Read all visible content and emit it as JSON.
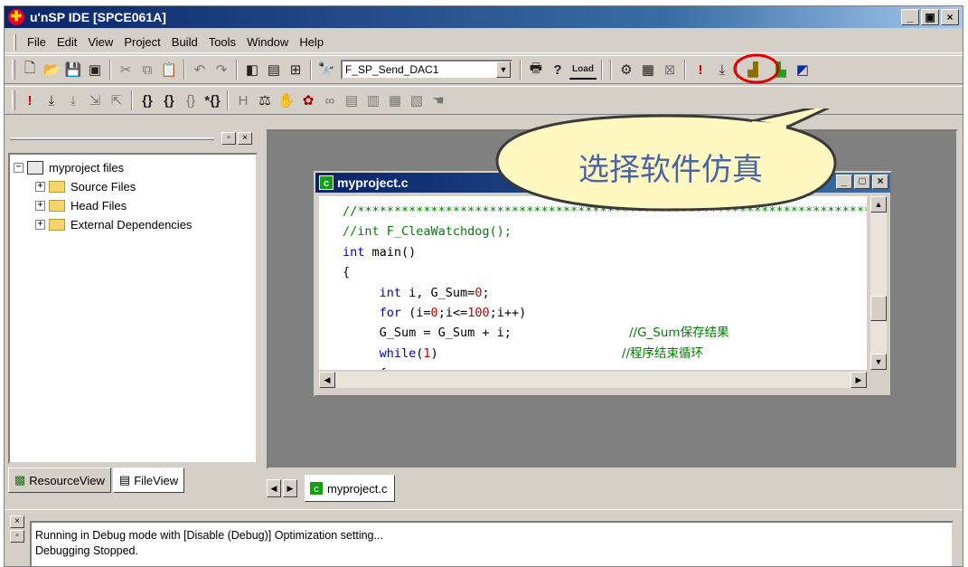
{
  "window": {
    "title": "u'nSP IDE [SPCE061A]",
    "min": "_",
    "max": "▣",
    "close": "×"
  },
  "menu": [
    "File",
    "Edit",
    "View",
    "Project",
    "Build",
    "Tools",
    "Window",
    "Help"
  ],
  "toolbar": {
    "function_combo": "F_SP_Send_DAC1",
    "load_label": "Load"
  },
  "callout": {
    "text": "选择软件仿真"
  },
  "left_pane": {
    "root": "myproject files",
    "items": [
      "Source Files",
      "Head Files",
      "External Dependencies"
    ],
    "tabs": [
      "ResourceView",
      "FileView"
    ]
  },
  "editor": {
    "title": "myproject.c",
    "tab_label": "myproject.c",
    "line1": "//**************************************************************************",
    "line2": "//int F_CleaWatchdog();",
    "line3_kw": "int",
    "line3_rest": " main()",
    "line4": "{",
    "line5_kw": "int",
    "line5_a": " i, G_Sum=",
    "line5_num": "0",
    "line5_b": ";",
    "line6_kw": "for",
    "line6_a": " (i=",
    "line6_n1": "0",
    "line6_b": ";i<=",
    "line6_n2": "100",
    "line6_c": ";i++)",
    "line7": "G_Sum = G_Sum + i;",
    "line7_comment": "//G_Sum保存结果",
    "line8_kw": "while",
    "line8_a": "(",
    "line8_num": "1",
    "line8_b": ")",
    "line8_comment": "//程序结束循环",
    "line9": "{"
  },
  "output": {
    "line1": "Running in Debug mode with [Disable (Debug)]  Optimization setting...",
    "line2": "Debugging Stopped."
  },
  "colors": {
    "title_bar": "#0a246a",
    "highlight_circle": "#e00000",
    "callout_fill": "#fff8c0",
    "callout_text": "#4a64a8"
  }
}
